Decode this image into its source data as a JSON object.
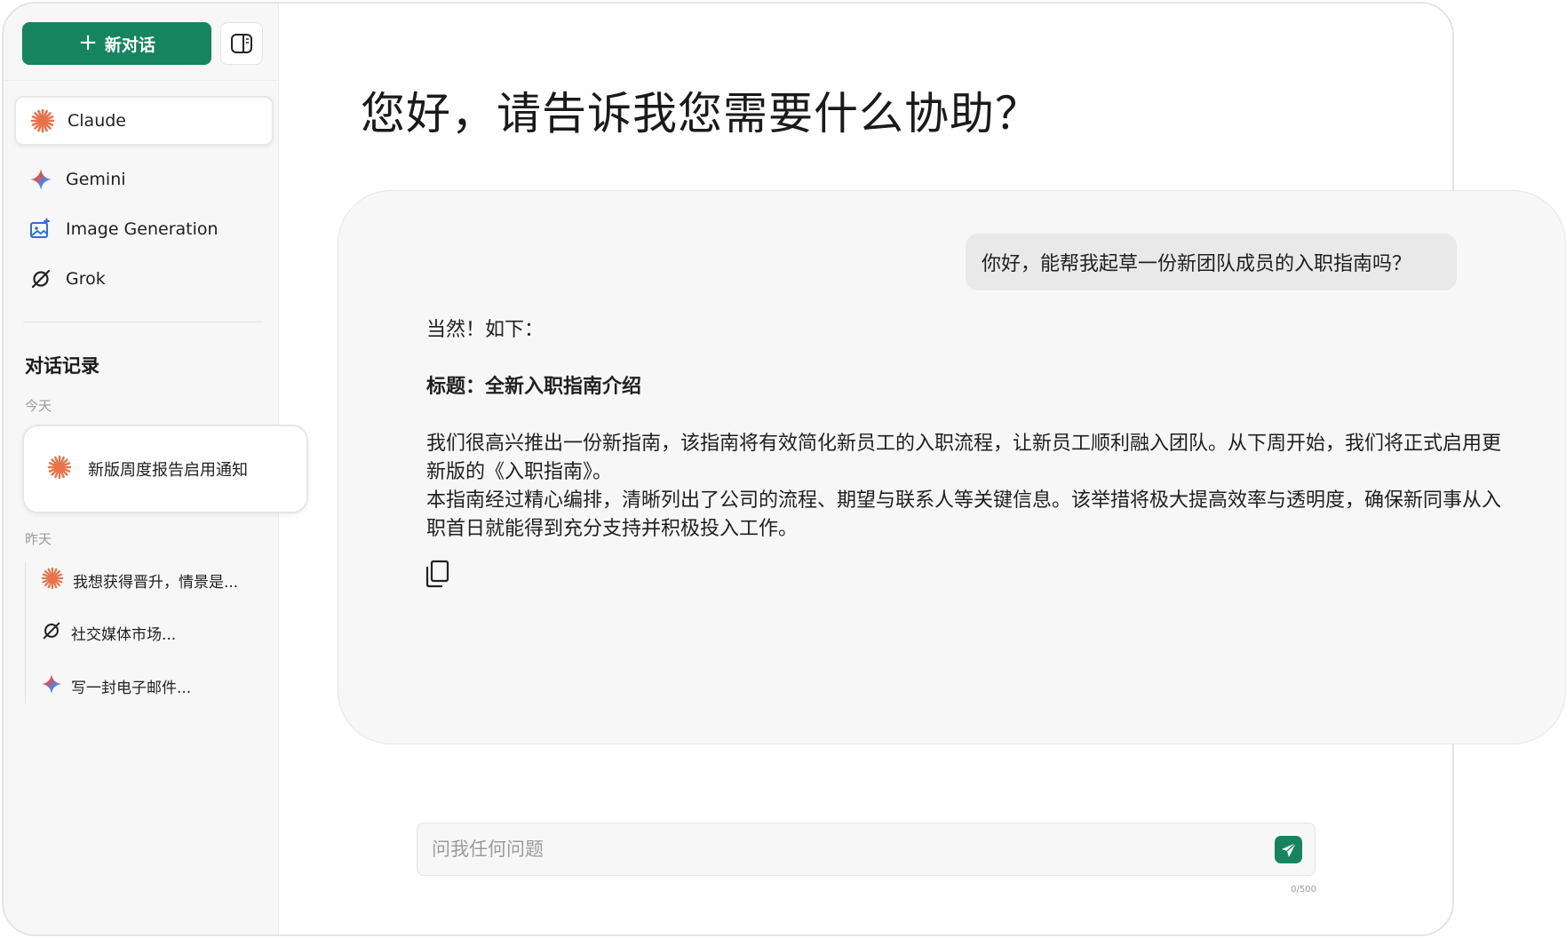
{
  "sidebar": {
    "new_chat_label": "新对话",
    "models": [
      {
        "label": "Claude",
        "icon": "claude-asterisk-icon",
        "active": true
      },
      {
        "label": "Gemini",
        "icon": "gemini-sparkle-icon",
        "active": false
      },
      {
        "label": "Image Generation",
        "icon": "image-edit-icon",
        "active": false
      },
      {
        "label": "Grok",
        "icon": "grok-icon",
        "active": false
      }
    ],
    "history_title": "对话记录",
    "groups": {
      "today_label": "今天",
      "yesterday_label": "昨天"
    },
    "today_items": [
      {
        "label": "新版周度报告启用通知",
        "icon": "claude-asterisk-icon"
      }
    ],
    "yesterday_items": [
      {
        "label": "我想获得晋升，情景是...",
        "icon": "claude-asterisk-icon"
      },
      {
        "label": "社交媒体市场...",
        "icon": "grok-icon"
      },
      {
        "label": "写一封电子邮件...",
        "icon": "gemini-sparkle-icon"
      }
    ]
  },
  "main": {
    "title": "您好，请告诉我您需要什么协助？",
    "user_message": "你好，能帮我起草一份新团队成员的入职指南吗？",
    "assistant": {
      "intro": "当然！如下：",
      "heading": "标题：全新入职指南介绍",
      "para1": "我们很高兴推出一份新指南，该指南将有效简化新员工的入职流程，让新员工顺利融入团队。从下周开始，我们将正式启用更新版的《入职指南》。",
      "para2": "本指南经过精心编排，清晰列出了公司的流程、期望与联系人等关键信息。该举措将极大提高效率与透明度，确保新同事从入职首日就能得到充分支持并积极投入工作。"
    },
    "input": {
      "placeholder": "问我任何问题",
      "value": "",
      "counter": "0/500"
    }
  },
  "colors": {
    "accent": "#15845f",
    "claude": "#e8734a",
    "panel": "#f7f7f7"
  }
}
